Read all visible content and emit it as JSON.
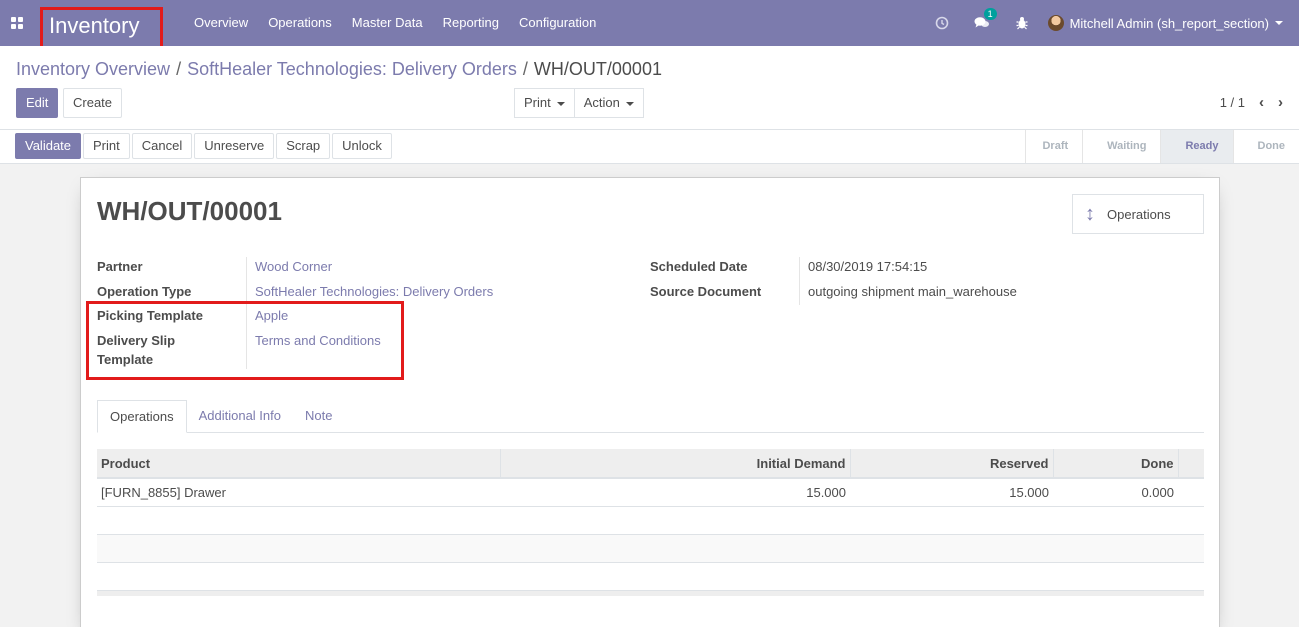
{
  "navbar": {
    "app_name": "Inventory",
    "menu": [
      "Overview",
      "Operations",
      "Master Data",
      "Reporting",
      "Configuration"
    ],
    "messages_count": "1",
    "user": "Mitchell Admin (sh_report_section)"
  },
  "breadcrumb": {
    "items": [
      "Inventory Overview",
      "SoftHealer Technologies: Delivery Orders",
      "WH/OUT/00001"
    ]
  },
  "buttons": {
    "edit": "Edit",
    "create": "Create",
    "print_menu": "Print",
    "action_menu": "Action"
  },
  "pager": {
    "value": "1 / 1"
  },
  "header_actions": [
    "Validate",
    "Print",
    "Cancel",
    "Unreserve",
    "Scrap",
    "Unlock"
  ],
  "stages": {
    "items": [
      "Draft",
      "Waiting",
      "Ready",
      "Done"
    ],
    "active": "Ready"
  },
  "record": {
    "title": "WH/OUT/00001",
    "smart_button": "Operations",
    "fields": {
      "partner_label": "Partner",
      "partner": "Wood Corner",
      "operation_type_label": "Operation Type",
      "operation_type": "SoftHealer Technologies: Delivery Orders",
      "picking_template_label": "Picking Template",
      "picking_template": "Apple",
      "delivery_slip_template_label": "Delivery Slip Template",
      "delivery_slip_template": "Terms and Conditions",
      "scheduled_date_label": "Scheduled Date",
      "scheduled_date": "08/30/2019 17:54:15",
      "source_document_label": "Source Document",
      "source_document": "outgoing shipment main_warehouse"
    }
  },
  "tabs": [
    "Operations",
    "Additional Info",
    "Note"
  ],
  "table": {
    "headers": [
      "Product",
      "Initial Demand",
      "Reserved",
      "Done"
    ],
    "rows": [
      {
        "product": "[FURN_8855] Drawer",
        "initial_demand": "15.000",
        "reserved": "15.000",
        "done": "0.000"
      }
    ]
  },
  "colors": {
    "brand": "#7c7bad",
    "highlight": "#e21b1b",
    "badge": "#00a09d"
  },
  "icons": [
    "apps-grid-icon",
    "clock-icon",
    "chat-icon",
    "bug-icon",
    "chevron-left-icon",
    "chevron-right-icon",
    "updown-arrows-icon"
  ]
}
